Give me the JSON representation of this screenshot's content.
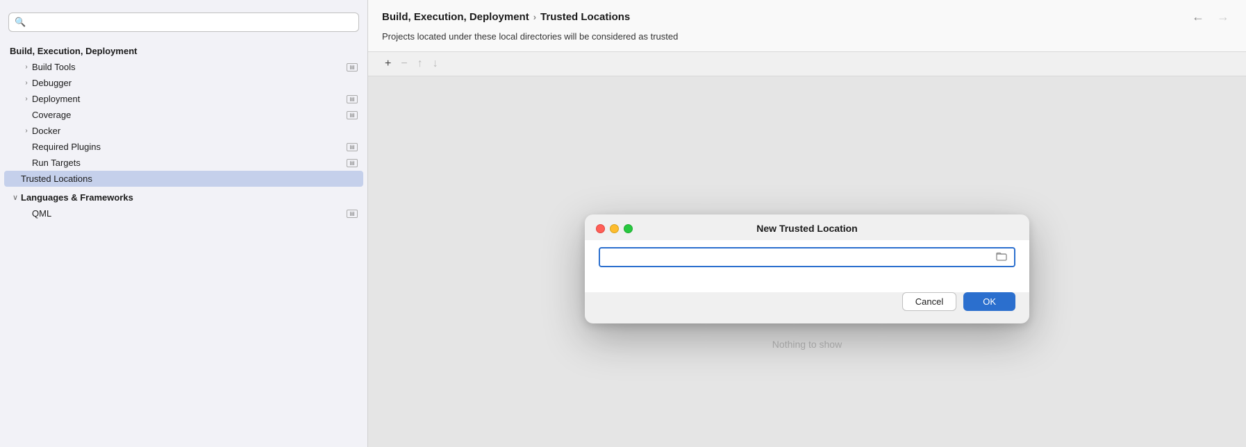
{
  "search": {
    "placeholder": "🔍"
  },
  "sidebar": {
    "section1": {
      "label": "Build, Execution, Deployment"
    },
    "items": [
      {
        "id": "build-tools",
        "label": "Build Tools",
        "hasChevron": true,
        "hasIcon": true,
        "indent": 1
      },
      {
        "id": "debugger",
        "label": "Debugger",
        "hasChevron": true,
        "hasIcon": false,
        "indent": 1
      },
      {
        "id": "deployment",
        "label": "Deployment",
        "hasChevron": true,
        "hasIcon": true,
        "indent": 1
      },
      {
        "id": "coverage",
        "label": "Coverage",
        "hasChevron": false,
        "hasIcon": true,
        "indent": 1
      },
      {
        "id": "docker",
        "label": "Docker",
        "hasChevron": true,
        "hasIcon": false,
        "indent": 1
      },
      {
        "id": "required-plugins",
        "label": "Required Plugins",
        "hasChevron": false,
        "hasIcon": true,
        "indent": 1
      },
      {
        "id": "run-targets",
        "label": "Run Targets",
        "hasChevron": false,
        "hasIcon": true,
        "indent": 1
      },
      {
        "id": "trusted-locations",
        "label": "Trusted Locations",
        "hasChevron": false,
        "hasIcon": false,
        "indent": 2,
        "active": true
      }
    ],
    "section2": {
      "label": "Languages & Frameworks",
      "expanded": true
    },
    "items2": [
      {
        "id": "qml",
        "label": "QML",
        "hasChevron": false,
        "hasIcon": true,
        "indent": 1
      }
    ]
  },
  "main": {
    "breadcrumb_parent": "Build, Execution, Deployment",
    "breadcrumb_separator": "›",
    "breadcrumb_current": "Trusted Locations",
    "description": "Projects located under these local directories will be considered as trusted",
    "nothing_to_show": "Nothing to show",
    "toolbar": {
      "add_label": "+",
      "remove_label": "−",
      "move_up_label": "↑",
      "move_down_label": "↓"
    },
    "nav_back": "←",
    "nav_forward": "→"
  },
  "dialog": {
    "title": "New Trusted Location",
    "input_placeholder": "",
    "cancel_label": "Cancel",
    "ok_label": "OK",
    "traffic_lights": [
      "red",
      "yellow",
      "green"
    ]
  }
}
